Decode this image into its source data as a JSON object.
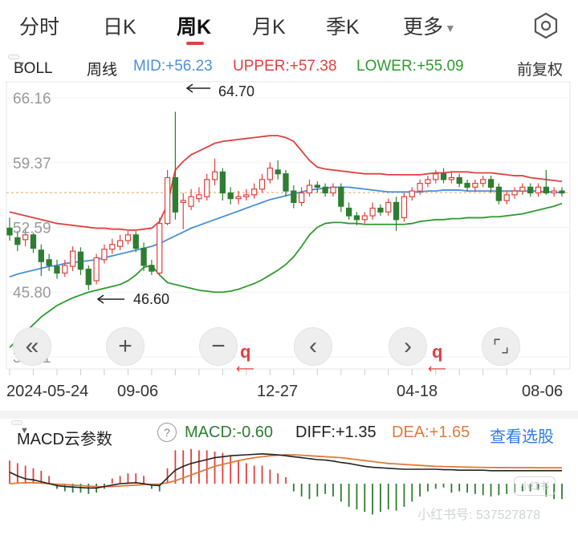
{
  "tabs": [
    {
      "label": "分时",
      "active": false
    },
    {
      "label": "日K",
      "active": false
    },
    {
      "label": "周K",
      "active": true
    },
    {
      "label": "月K",
      "active": false
    },
    {
      "label": "季K",
      "active": false
    },
    {
      "label": "更多",
      "active": false
    }
  ],
  "icons": {
    "settings": "hexagon-gear-icon",
    "more_caret": "caret-down-icon"
  },
  "indicator": {
    "name": "BOLL",
    "period": "周线",
    "mid": "MID:+56.23",
    "upper": "UPPER:+57.38",
    "lower": "LOWER:+55.09",
    "adjust": "前复权"
  },
  "colors": {
    "up": "#e04040",
    "down": "#2e7d32",
    "mid": "#4a90d9",
    "upper": "#e04040",
    "lower": "#2e9b2e",
    "dea": "#e07a3a",
    "diff": "#222222",
    "accent": "#2b7de9"
  },
  "price_axis": {
    "ticks": [
      "66.16",
      "59.37",
      "52.59",
      "45.80",
      "39.01"
    ]
  },
  "annotations": {
    "high": "64.70",
    "low": "46.60"
  },
  "dates": [
    "2024-05-24",
    "09-06",
    "12-27",
    "04-18",
    "08-06"
  ],
  "zoom_buttons": [
    "«",
    "+",
    "−",
    "‹",
    "›",
    "⌜⌟"
  ],
  "zoom_labels": {
    "q": "q",
    "arrow": "⟵"
  },
  "macd": {
    "selector": "MACD云参数",
    "help": "?",
    "macd": "MACD:-0.60",
    "diff": "DIFF:+1.35",
    "dea": "DEA:+1.65",
    "link": "查看选股"
  },
  "watermark": {
    "text": "小红书号: 537527878",
    "logo": "小红书"
  },
  "chart_data": {
    "type": "candlestick",
    "ylim": [
      39.01,
      66.16
    ],
    "candles": [
      [
        52.5,
        51.8,
        53.6,
        51.2
      ],
      [
        51.5,
        50.8,
        52.2,
        50.1
      ],
      [
        51.3,
        51.8,
        52.5,
        50.6
      ],
      [
        51.8,
        50.4,
        52.0,
        49.9
      ],
      [
        50.2,
        49.0,
        50.8,
        47.5
      ],
      [
        49.2,
        48.6,
        49.8,
        48.0
      ],
      [
        48.5,
        47.8,
        49.2,
        47.2
      ],
      [
        47.8,
        48.6,
        49.2,
        47.4
      ],
      [
        48.5,
        50.1,
        50.6,
        48.0
      ],
      [
        50.0,
        48.2,
        50.5,
        47.6
      ],
      [
        48.2,
        46.6,
        48.6,
        46.0
      ],
      [
        47.0,
        49.4,
        49.8,
        46.6
      ],
      [
        49.2,
        50.3,
        50.8,
        48.8
      ],
      [
        50.3,
        50.8,
        51.4,
        49.8
      ],
      [
        50.6,
        51.2,
        51.8,
        50.2
      ],
      [
        51.2,
        51.8,
        52.2,
        50.8
      ],
      [
        51.8,
        50.4,
        52.2,
        50.0
      ],
      [
        50.4,
        48.6,
        51.0,
        48.0
      ],
      [
        48.6,
        48.0,
        49.2,
        47.6
      ],
      [
        47.8,
        53.0,
        53.6,
        47.6
      ],
      [
        53.0,
        57.8,
        58.6,
        52.8
      ],
      [
        57.8,
        54.2,
        64.7,
        53.4
      ],
      [
        55.2,
        55.4,
        56.2,
        52.4
      ],
      [
        54.8,
        55.8,
        56.6,
        54.4
      ],
      [
        55.6,
        56.0,
        56.8,
        55.2
      ],
      [
        55.8,
        57.6,
        58.2,
        55.4
      ],
      [
        57.6,
        58.4,
        59.8,
        57.0
      ],
      [
        58.4,
        56.2,
        58.8,
        55.4
      ],
      [
        56.2,
        55.6,
        56.8,
        55.0
      ],
      [
        55.6,
        55.8,
        56.4,
        55.0
      ],
      [
        55.8,
        56.0,
        56.6,
        55.4
      ],
      [
        56.0,
        56.6,
        57.2,
        55.6
      ],
      [
        56.6,
        57.6,
        58.2,
        56.2
      ],
      [
        57.6,
        58.8,
        59.4,
        57.2
      ],
      [
        58.6,
        58.2,
        59.6,
        57.6
      ],
      [
        58.2,
        56.4,
        58.6,
        55.8
      ],
      [
        56.4,
        55.2,
        57.0,
        54.6
      ],
      [
        55.2,
        56.2,
        56.8,
        54.8
      ],
      [
        56.2,
        57.0,
        57.6,
        55.8
      ],
      [
        57.0,
        56.8,
        57.4,
        56.2
      ],
      [
        56.8,
        56.2,
        57.2,
        55.8
      ],
      [
        56.2,
        56.8,
        57.2,
        55.8
      ],
      [
        56.8,
        54.8,
        57.2,
        54.2
      ],
      [
        54.6,
        53.8,
        55.2,
        53.4
      ],
      [
        53.8,
        53.4,
        54.2,
        52.8
      ],
      [
        53.4,
        53.8,
        54.2,
        53.0
      ],
      [
        53.8,
        54.6,
        55.2,
        53.4
      ],
      [
        54.6,
        54.2,
        55.0,
        53.8
      ],
      [
        54.2,
        55.2,
        55.6,
        53.8
      ],
      [
        55.2,
        53.4,
        55.8,
        52.2
      ],
      [
        53.6,
        55.8,
        56.2,
        53.2
      ],
      [
        55.8,
        56.4,
        56.8,
        55.4
      ],
      [
        56.4,
        57.2,
        57.6,
        56.0
      ],
      [
        57.2,
        57.6,
        58.0,
        56.8
      ],
      [
        57.6,
        58.2,
        58.6,
        57.2
      ],
      [
        58.2,
        57.6,
        58.8,
        57.2
      ],
      [
        57.6,
        57.8,
        58.4,
        57.2
      ],
      [
        57.8,
        57.2,
        58.2,
        56.8
      ],
      [
        57.2,
        56.8,
        57.6,
        56.4
      ],
      [
        56.8,
        57.2,
        57.6,
        56.4
      ],
      [
        57.2,
        57.6,
        58.0,
        56.8
      ],
      [
        57.6,
        56.8,
        58.0,
        56.2
      ],
      [
        56.8,
        55.4,
        57.2,
        55.0
      ],
      [
        55.4,
        56.0,
        56.4,
        55.0
      ],
      [
        56.0,
        56.4,
        56.8,
        55.6
      ],
      [
        56.4,
        56.8,
        57.2,
        56.0
      ],
      [
        56.8,
        56.2,
        57.2,
        55.8
      ],
      [
        56.2,
        56.8,
        57.2,
        55.8
      ],
      [
        56.8,
        56.2,
        58.6,
        56.0
      ],
      [
        56.2,
        56.4,
        56.8,
        55.8
      ],
      [
        56.4,
        56.2,
        56.8,
        55.8
      ]
    ],
    "boll_upper": [
      54.2,
      54.0,
      53.8,
      53.6,
      53.4,
      53.2,
      53.0,
      52.9,
      52.8,
      52.7,
      52.6,
      52.5,
      52.5,
      52.4,
      52.4,
      52.3,
      52.3,
      52.4,
      52.5,
      53.2,
      55.0,
      58.6,
      59.5,
      60.2,
      60.6,
      61.0,
      61.4,
      61.6,
      61.7,
      61.8,
      61.9,
      62.0,
      62.1,
      62.2,
      62.2,
      62.0,
      61.6,
      60.6,
      59.6,
      58.9,
      58.7,
      58.6,
      58.5,
      58.4,
      58.3,
      58.2,
      58.2,
      58.2,
      58.1,
      58.1,
      58.1,
      58.1,
      58.1,
      58.2,
      58.3,
      58.3,
      58.4,
      58.4,
      58.4,
      58.3,
      58.3,
      58.3,
      58.2,
      58.1,
      58.0,
      58.0,
      57.8,
      57.7,
      57.6,
      57.5,
      57.4
    ],
    "boll_mid": [
      47.4,
      47.7,
      47.9,
      48.1,
      48.3,
      48.5,
      48.6,
      48.8,
      48.9,
      49.0,
      49.1,
      49.2,
      49.4,
      49.6,
      49.8,
      50.0,
      50.2,
      50.4,
      50.6,
      50.9,
      51.3,
      51.7,
      52.1,
      52.5,
      52.8,
      53.1,
      53.4,
      53.7,
      54.0,
      54.3,
      54.6,
      54.9,
      55.2,
      55.5,
      55.7,
      55.9,
      56.1,
      56.3,
      56.5,
      56.6,
      56.7,
      56.8,
      56.8,
      56.8,
      56.7,
      56.6,
      56.5,
      56.4,
      56.3,
      56.3,
      56.3,
      56.3,
      56.3,
      56.4,
      56.4,
      56.5,
      56.5,
      56.5,
      56.4,
      56.4,
      56.4,
      56.4,
      56.4,
      56.4,
      56.4,
      56.4,
      56.4,
      56.4,
      56.3,
      56.3,
      56.2
    ],
    "boll_lower": [
      40.0,
      40.8,
      41.6,
      42.4,
      43.2,
      43.8,
      44.4,
      44.8,
      45.2,
      45.5,
      45.8,
      46.0,
      46.2,
      46.4,
      46.6,
      47.0,
      47.6,
      48.4,
      48.6,
      47.6,
      46.8,
      46.6,
      46.4,
      46.2,
      46.0,
      45.9,
      45.8,
      45.8,
      45.9,
      46.1,
      46.4,
      46.7,
      47.1,
      47.6,
      48.1,
      48.7,
      49.5,
      50.6,
      51.8,
      52.6,
      53.0,
      53.1,
      53.1,
      53.0,
      53.0,
      52.9,
      52.9,
      52.9,
      52.9,
      52.9,
      52.9,
      53.0,
      53.2,
      53.3,
      53.4,
      53.4,
      53.5,
      53.5,
      53.6,
      53.6,
      53.6,
      53.7,
      53.7,
      53.8,
      53.9,
      54.0,
      54.2,
      54.4,
      54.6,
      54.8,
      55.1
    ],
    "macd_hist": [
      0.9,
      0.8,
      0.7,
      0.6,
      0.5,
      0.3,
      -0.2,
      -0.3,
      -0.35,
      -0.35,
      -0.4,
      -0.35,
      -0.2,
      0.2,
      0.3,
      0.4,
      0.4,
      0.3,
      -0.2,
      -0.3,
      0.6,
      1.3,
      1.3,
      1.35,
      1.3,
      1.3,
      1.25,
      1.2,
      1.1,
      0.9,
      0.8,
      0.7,
      0.7,
      0.55,
      0.4,
      0.25,
      -0.3,
      -0.5,
      -0.6,
      -0.5,
      -0.4,
      -0.5,
      -0.7,
      -0.9,
      -1.0,
      -1.1,
      -1.2,
      -1.1,
      -1.0,
      -1.05,
      -0.9,
      -0.7,
      -0.5,
      -0.3,
      -0.2,
      -0.15,
      -0.35,
      -0.3,
      -0.35,
      -0.4,
      -0.45,
      -0.5,
      -0.45,
      -0.4,
      -0.35,
      -0.3,
      -0.3,
      -0.25,
      -0.5,
      -0.6,
      -0.6
    ],
    "macd_diff": [
      1.2,
      0.8,
      0.5,
      0.4,
      0.2,
      0.0,
      -0.2,
      -0.3,
      -0.35,
      -0.4,
      -0.45,
      -0.45,
      -0.3,
      -0.15,
      0.0,
      0.05,
      0.1,
      0.0,
      -0.15,
      -0.2,
      0.6,
      1.4,
      1.8,
      2.1,
      2.3,
      2.5,
      2.7,
      2.8,
      2.9,
      2.95,
      3.0,
      3.05,
      3.1,
      3.05,
      3.0,
      2.9,
      2.8,
      2.7,
      2.6,
      2.5,
      2.45,
      2.35,
      2.2,
      2.1,
      1.95,
      1.8,
      1.7,
      1.65,
      1.6,
      1.55,
      1.5,
      1.5,
      1.5,
      1.5,
      1.5,
      1.45,
      1.45,
      1.4,
      1.4,
      1.4,
      1.4,
      1.35,
      1.35,
      1.35,
      1.35,
      1.35,
      1.35,
      1.35,
      1.35,
      1.35,
      1.35
    ],
    "macd_dea": [
      0.0,
      0.05,
      0.1,
      0.1,
      0.05,
      0.0,
      -0.05,
      -0.1,
      -0.15,
      -0.2,
      -0.25,
      -0.3,
      -0.3,
      -0.3,
      -0.25,
      -0.2,
      -0.15,
      -0.1,
      -0.05,
      -0.05,
      0.1,
      0.3,
      0.6,
      0.9,
      1.2,
      1.5,
      1.8,
      2.0,
      2.2,
      2.4,
      2.55,
      2.7,
      2.8,
      2.9,
      2.95,
      3.0,
      3.0,
      2.95,
      2.9,
      2.85,
      2.8,
      2.75,
      2.7,
      2.6,
      2.5,
      2.4,
      2.3,
      2.2,
      2.1,
      2.05,
      2.0,
      1.95,
      1.9,
      1.85,
      1.8,
      1.78,
      1.76,
      1.74,
      1.72,
      1.7,
      1.69,
      1.68,
      1.67,
      1.67,
      1.66,
      1.66,
      1.66,
      1.65,
      1.65,
      1.65,
      1.65
    ]
  }
}
